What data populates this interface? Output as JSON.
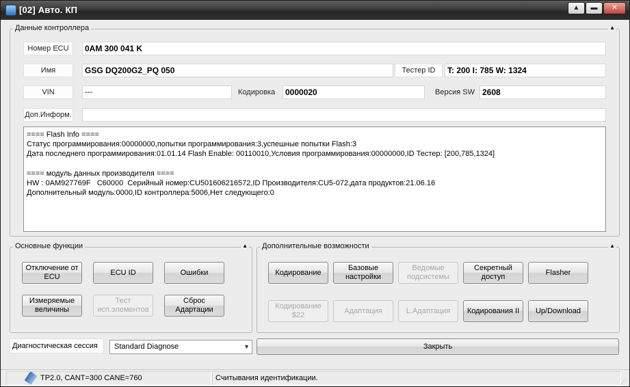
{
  "window": {
    "title": "[02] Авто. КП"
  },
  "data_group": {
    "title": "Данные контроллера",
    "ecu_number_label": "Номер ECU",
    "ecu_number_value": "0AM 300 041 K",
    "name_label": "Имя",
    "name_value": "GSG DQ200G2_PQ  050",
    "tester_id_label": "Тестер ID",
    "tester_id_value": "T: 200 I: 785 W: 1324",
    "vin_label": "VIN",
    "vin_value": "---",
    "coding_label": "Кодировка",
    "coding_value": "0000020",
    "sw_version_label": "Версия SW",
    "sw_version_value": "2608",
    "extra_info_label": "Доп.Информ.",
    "extra_info_value": "",
    "info_lines": [
      "==== Flash Info ====",
      "Статус программирования:00000000,попытки программирования:3,успешные попытки Flash:3",
      "Дата последнего программирования:01.01.14 Flash Enable: 00110010,Условия программирования:00000000,ID Тестер: [200,785,1324]",
      "",
      "==== модуль данных производителя ====",
      "HW : 0AM927769F   C60000  Серийный номер:CU501606216572,ID Производителя:CU5-072,дата продуктов:21.06.16",
      "Дополнительный модуль:0000,ID контроллера:5006,Нет следующего:0"
    ]
  },
  "main_functions": {
    "title": "Основные функции",
    "buttons": [
      {
        "label": "Отключение от ECU",
        "enabled": true
      },
      {
        "label": "ECU ID",
        "enabled": true
      },
      {
        "label": "Ошибки",
        "enabled": true
      },
      {
        "label": "Измеряемые величины",
        "enabled": true
      },
      {
        "label": "Тест исп.элементов",
        "enabled": false
      },
      {
        "label": "Сброс Адартации",
        "enabled": true
      }
    ]
  },
  "extra_functions": {
    "title": "Дополнительные возможности",
    "buttons": [
      {
        "label": "Кодирование",
        "enabled": true
      },
      {
        "label": "Базовые настройки",
        "enabled": true
      },
      {
        "label": "Ведомые подсистемы",
        "enabled": false
      },
      {
        "label": "Секретный доступ",
        "enabled": true
      },
      {
        "label": "Flasher",
        "enabled": true
      },
      {
        "label": "Кодирование $22",
        "enabled": false
      },
      {
        "label": "Адаптация",
        "enabled": false
      },
      {
        "label": "L.Адаптация",
        "enabled": false
      },
      {
        "label": "Кодирования II",
        "enabled": true
      },
      {
        "label": "Up/Download",
        "enabled": true
      }
    ]
  },
  "diagnostic_session": {
    "label": "Диагностическая сессия",
    "selected": "Standard Diagnose"
  },
  "close_button": "Закрыть",
  "status_bar": {
    "protocol": "TP2.0, CANT=300 CANE=760",
    "message": "Считывания идентификации."
  }
}
